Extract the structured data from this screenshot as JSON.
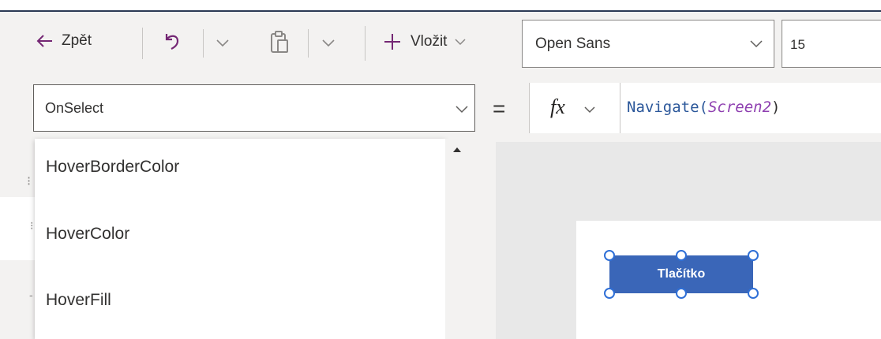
{
  "toolbar": {
    "back_label": "Zpět",
    "insert_label": "Vložit",
    "font_value": "Open Sans",
    "size_value": "15"
  },
  "formula": {
    "property_value": "OnSelect",
    "equals": "=",
    "fx_label": "fx",
    "func_name": "Navigate(",
    "arg": "Screen2",
    "close_paren": ")"
  },
  "property_list": {
    "items": [
      {
        "label": "HoverBorderColor"
      },
      {
        "label": "HoverColor"
      },
      {
        "label": "HoverFill"
      }
    ]
  },
  "canvas": {
    "button_label": "Tlačítko"
  },
  "colors": {
    "accent": "#742774",
    "button": "#3a66b8",
    "selection": "#2f6fd6"
  }
}
